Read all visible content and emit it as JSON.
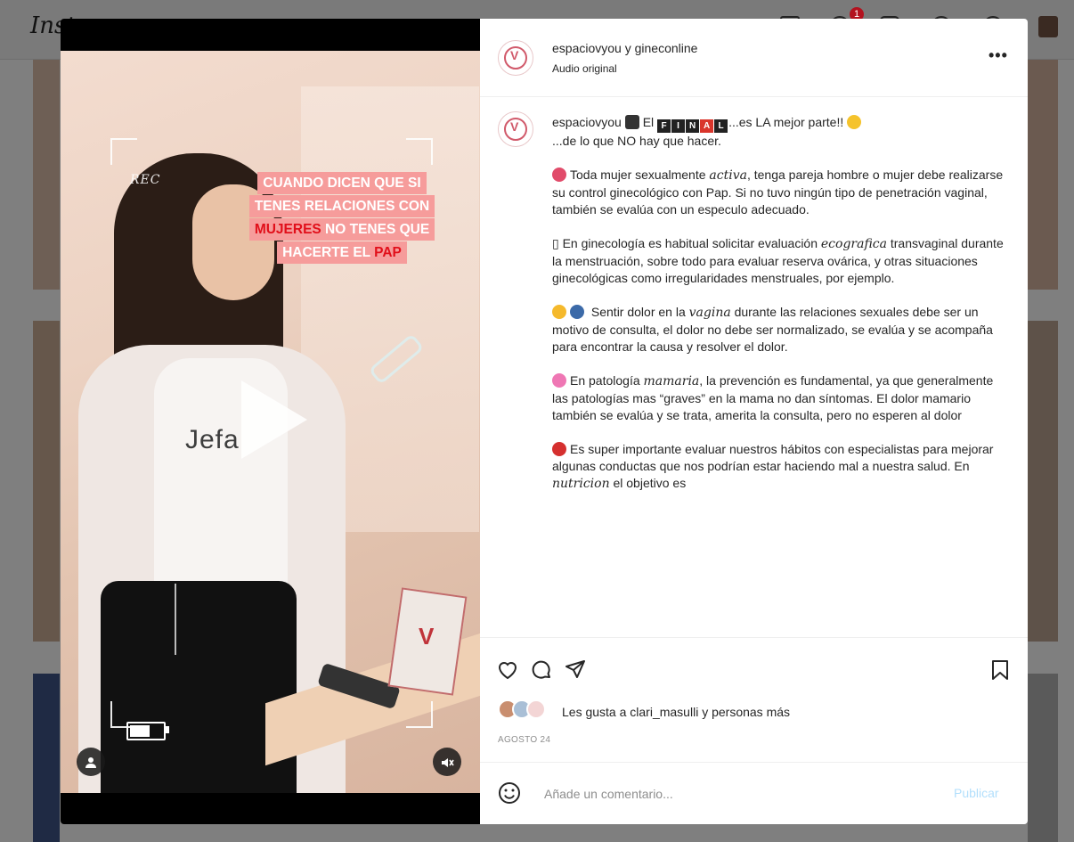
{
  "background": {
    "logo_text": "Inst",
    "notification_count": "1"
  },
  "video": {
    "rec_label": "REC",
    "caption_lines": [
      {
        "pre": "CUANDO DICEN QUE SI",
        "red": "",
        "post": ""
      },
      {
        "pre": "TENES RELACIONES CON",
        "red": "",
        "post": ""
      },
      {
        "pre": "",
        "red": "MUJERES",
        "post": " NO TENES QUE"
      },
      {
        "pre": "HACERTE EL ",
        "red": "PAP",
        "post": ""
      }
    ],
    "shirt_text": "Jefa"
  },
  "post": {
    "header_name": "espaciovyou y gineconline",
    "header_sub": "Audio original",
    "more_label": "•••",
    "caption_user": "espaciovyou",
    "caption_intro_a": "El ",
    "caption_final_tiles": [
      "F",
      "I",
      "N",
      "A",
      "L"
    ],
    "caption_intro_b": "...es LA mejor parte!! ",
    "caption_line2": "...de lo que NO hay que hacer.",
    "p1_a": "Toda mujer sexualmente ",
    "p1_ital": "activa",
    "p1_b": ", tenga pareja hombre o mujer debe realizarse su control ginecológico con Pap. Si no tuvo ningún tipo de penetración vaginal, también se evalúa con un especulo adecuado.",
    "p2_a": "▯ En ginecología es habitual solicitar evaluación ",
    "p2_ital": "ecografica",
    "p2_b": " transvaginal durante la menstruación, sobre todo para evaluar reserva ovárica, y otras situaciones ginecológicas como irregularidades menstruales, por ejemplo.",
    "p3_a": " Sentir dolor en la ",
    "p3_ital": "vagina",
    "p3_b": " durante las relaciones sexuales debe ser un motivo de consulta, el dolor no debe ser normalizado, se evalúa y se acompaña para encontrar la causa y resolver el dolor.",
    "p4_a": "En patología ",
    "p4_ital": "mamaria",
    "p4_b": ", la prevención es fundamental, ya que generalmente las patologías mas “graves” en la mama no dan síntomas. El dolor mamario también se evalúa y se trata, amerita la consulta, pero no esperen al dolor",
    "p5_a": "Es super importante evaluar nuestros hábitos con especialistas para mejorar algunas conductas que nos podrían estar haciendo mal a nuestra salud. En ",
    "p5_ital": "nutricion",
    "p5_b": " el objetivo es",
    "likes_prefix": "Les gusta a ",
    "likes_user": "clari_masulli",
    "likes_suffix": " y personas más",
    "date": "AGOSTO 24",
    "comment_placeholder": "Añade un comentario...",
    "publish_label": "Publicar"
  },
  "colors": {
    "caption_highlight": "#f69c9b",
    "caption_red": "#e10f1a",
    "publish_disabled": "#b2dffc",
    "brand_pink": "#d15a6b"
  }
}
